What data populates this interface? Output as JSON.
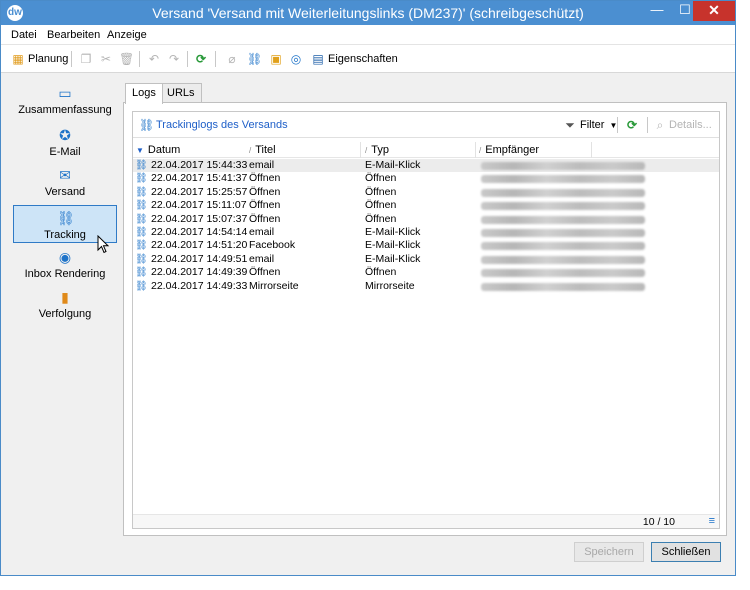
{
  "window": {
    "title": "Versand 'Versand mit Weiterleitungslinks (DM237)' (schreibgeschützt)",
    "app_icon": "dw",
    "controls": {
      "minimize": "—",
      "maximize": "☐",
      "close": "✕"
    }
  },
  "menu": [
    "Datei",
    "Bearbeiten",
    "Anzeige"
  ],
  "toolbar": {
    "planning_label": "Planung",
    "properties_label": "Eigenschaften"
  },
  "nav": {
    "items": [
      {
        "label": "Zusammenfassung",
        "icon": "summary-icon"
      },
      {
        "label": "E-Mail",
        "icon": "email-icon"
      },
      {
        "label": "Versand",
        "icon": "delivery-icon"
      },
      {
        "label": "Tracking",
        "icon": "tracking-icon"
      },
      {
        "label": "Inbox Rendering",
        "icon": "globe-icon"
      },
      {
        "label": "Verfolgung",
        "icon": "audit-icon"
      }
    ],
    "selected": "Tracking"
  },
  "tabs": [
    "Logs",
    "URLs"
  ],
  "panel": {
    "link_label": "Trackinglogs des Versands",
    "filter_label": "Filter",
    "details_label": "Details..."
  },
  "columns": {
    "date": "Datum",
    "title": "Titel",
    "type": "Typ",
    "recipient": "Empfänger"
  },
  "rows": [
    {
      "date": "22.04.2017 15:44:33",
      "title": "email",
      "type": "E-Mail-Klick"
    },
    {
      "date": "22.04.2017 15:41:37",
      "title": "Öffnen",
      "type": "Öffnen"
    },
    {
      "date": "22.04.2017 15:25:57",
      "title": "Öffnen",
      "type": "Öffnen"
    },
    {
      "date": "22.04.2017 15:11:07",
      "title": "Öffnen",
      "type": "Öffnen"
    },
    {
      "date": "22.04.2017 15:07:37",
      "title": "Öffnen",
      "type": "Öffnen"
    },
    {
      "date": "22.04.2017 14:54:14",
      "title": "email",
      "type": "E-Mail-Klick"
    },
    {
      "date": "22.04.2017 14:51:20",
      "title": "Facebook",
      "type": "E-Mail-Klick"
    },
    {
      "date": "22.04.2017 14:49:51",
      "title": "email",
      "type": "E-Mail-Klick"
    },
    {
      "date": "22.04.2017 14:49:39",
      "title": "Öffnen",
      "type": "Öffnen"
    },
    {
      "date": "22.04.2017 14:49:33",
      "title": "Mirrorseite",
      "type": "Mirrorseite"
    }
  ],
  "record_count": "10 / 10",
  "buttons": {
    "save": "Speichern",
    "close": "Schließen"
  },
  "colors": {
    "titlebar": "#4b8fd1",
    "accent": "#1e73c8",
    "close": "#c7332c",
    "selected_nav": "#cde4f7"
  }
}
